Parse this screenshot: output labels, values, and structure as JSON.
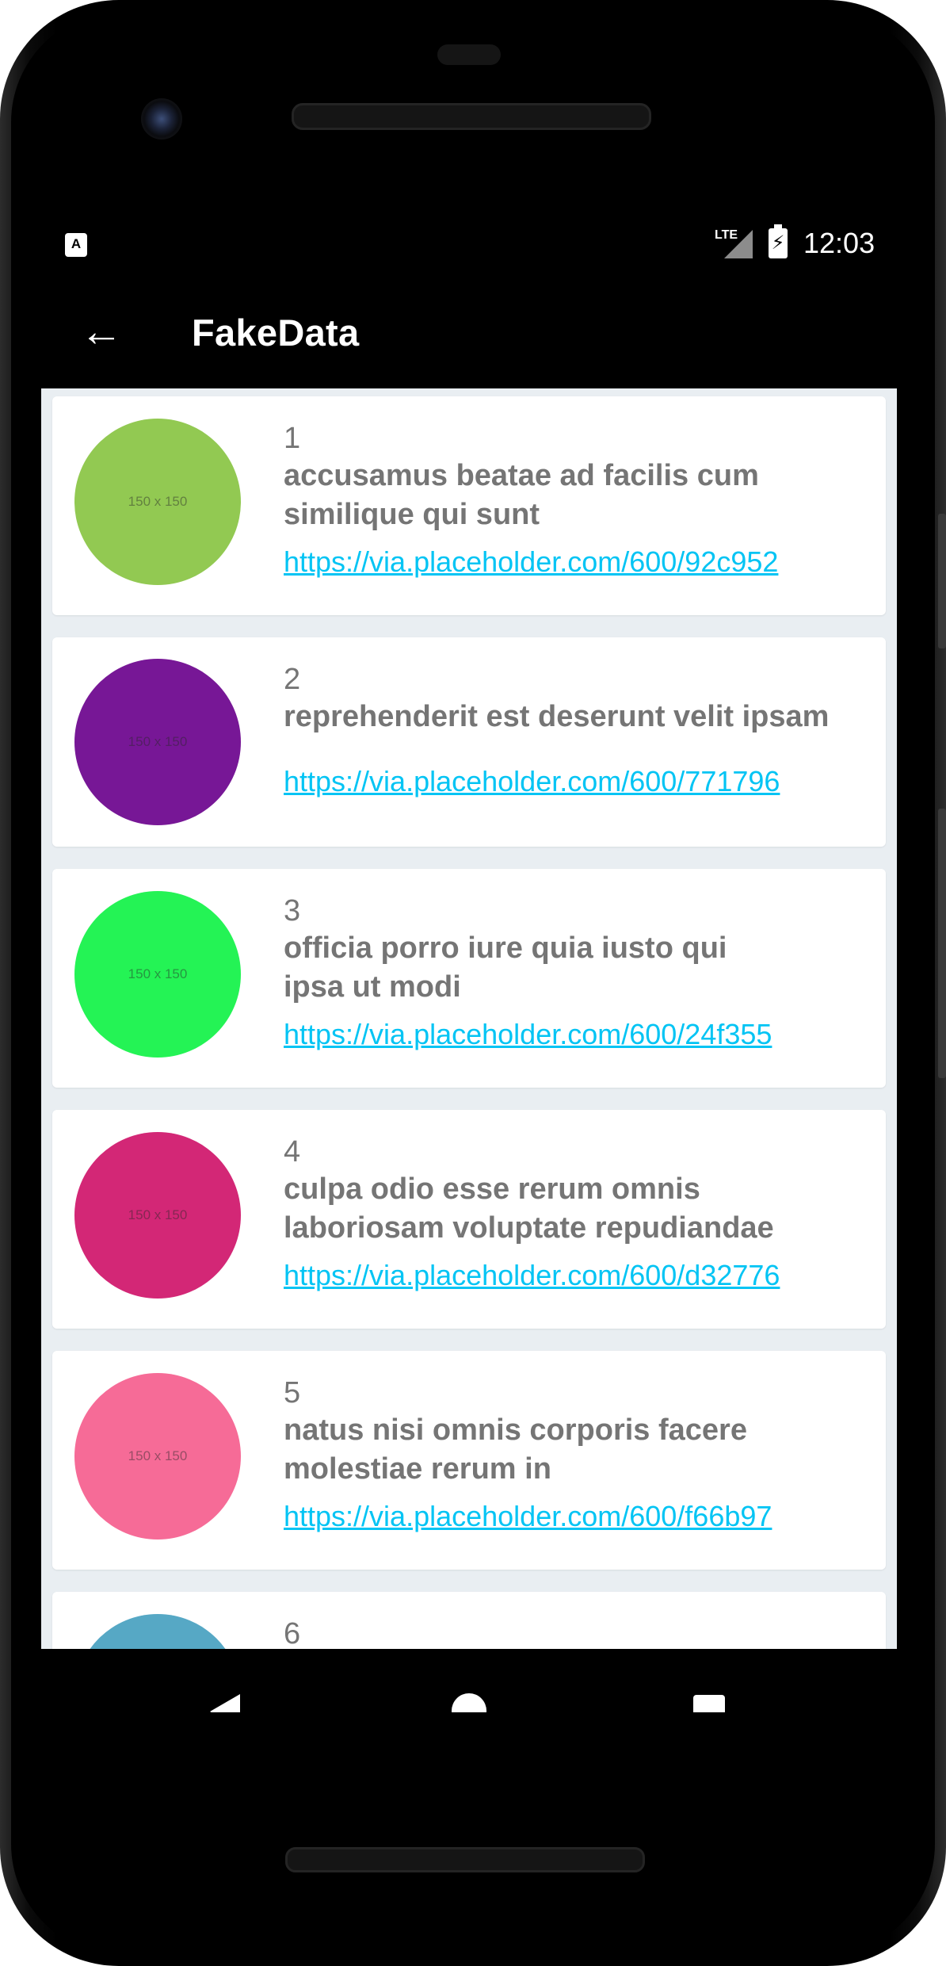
{
  "status_bar": {
    "notification_icon": "a-letter-icon",
    "notification_glyph": "A",
    "network_label": "LTE",
    "time": "12:03"
  },
  "app_bar": {
    "back_icon": "arrow-left-icon",
    "title": "FakeData"
  },
  "cards": [
    {
      "id": "1",
      "title": "accusamus beatae ad facilis cum similique qui sunt",
      "url": "https://via.placeholder.com/600/92c952",
      "thumb_color": "#92c952",
      "thumb_label": "150 x 150"
    },
    {
      "id": "2",
      "title": "reprehenderit est deserunt velit ipsam",
      "url": "https://via.placeholder.com/600/771796",
      "thumb_color": "#771796",
      "thumb_label": "150 x 150"
    },
    {
      "id": "3",
      "title": "officia porro iure quia iusto qui ipsa ut modi",
      "url": "https://via.placeholder.com/600/24f355",
      "thumb_color": "#24f355",
      "thumb_label": "150 x 150"
    },
    {
      "id": "4",
      "title": "culpa odio esse rerum omnis laboriosam voluptate repudiandae",
      "url": "https://via.placeholder.com/600/d32776",
      "thumb_color": "#d32776",
      "thumb_label": "150 x 150"
    },
    {
      "id": "5",
      "title": "natus nisi omnis corporis facere molestiae rerum in",
      "url": "https://via.placeholder.com/600/f66b97",
      "thumb_color": "#f66b97",
      "thumb_label": "150 x 150"
    },
    {
      "id": "6",
      "title": "",
      "url": "",
      "thumb_color": "#56a8c5",
      "thumb_label": ""
    }
  ],
  "nav_bar": {
    "back_icon": "triangle-back-icon",
    "home_icon": "circle-home-icon",
    "recents_icon": "square-recents-icon"
  },
  "colors": {
    "link": "#03c4f4",
    "text_gray": "#757575",
    "list_background": "#e9eef2",
    "app_bar": "#000000"
  }
}
